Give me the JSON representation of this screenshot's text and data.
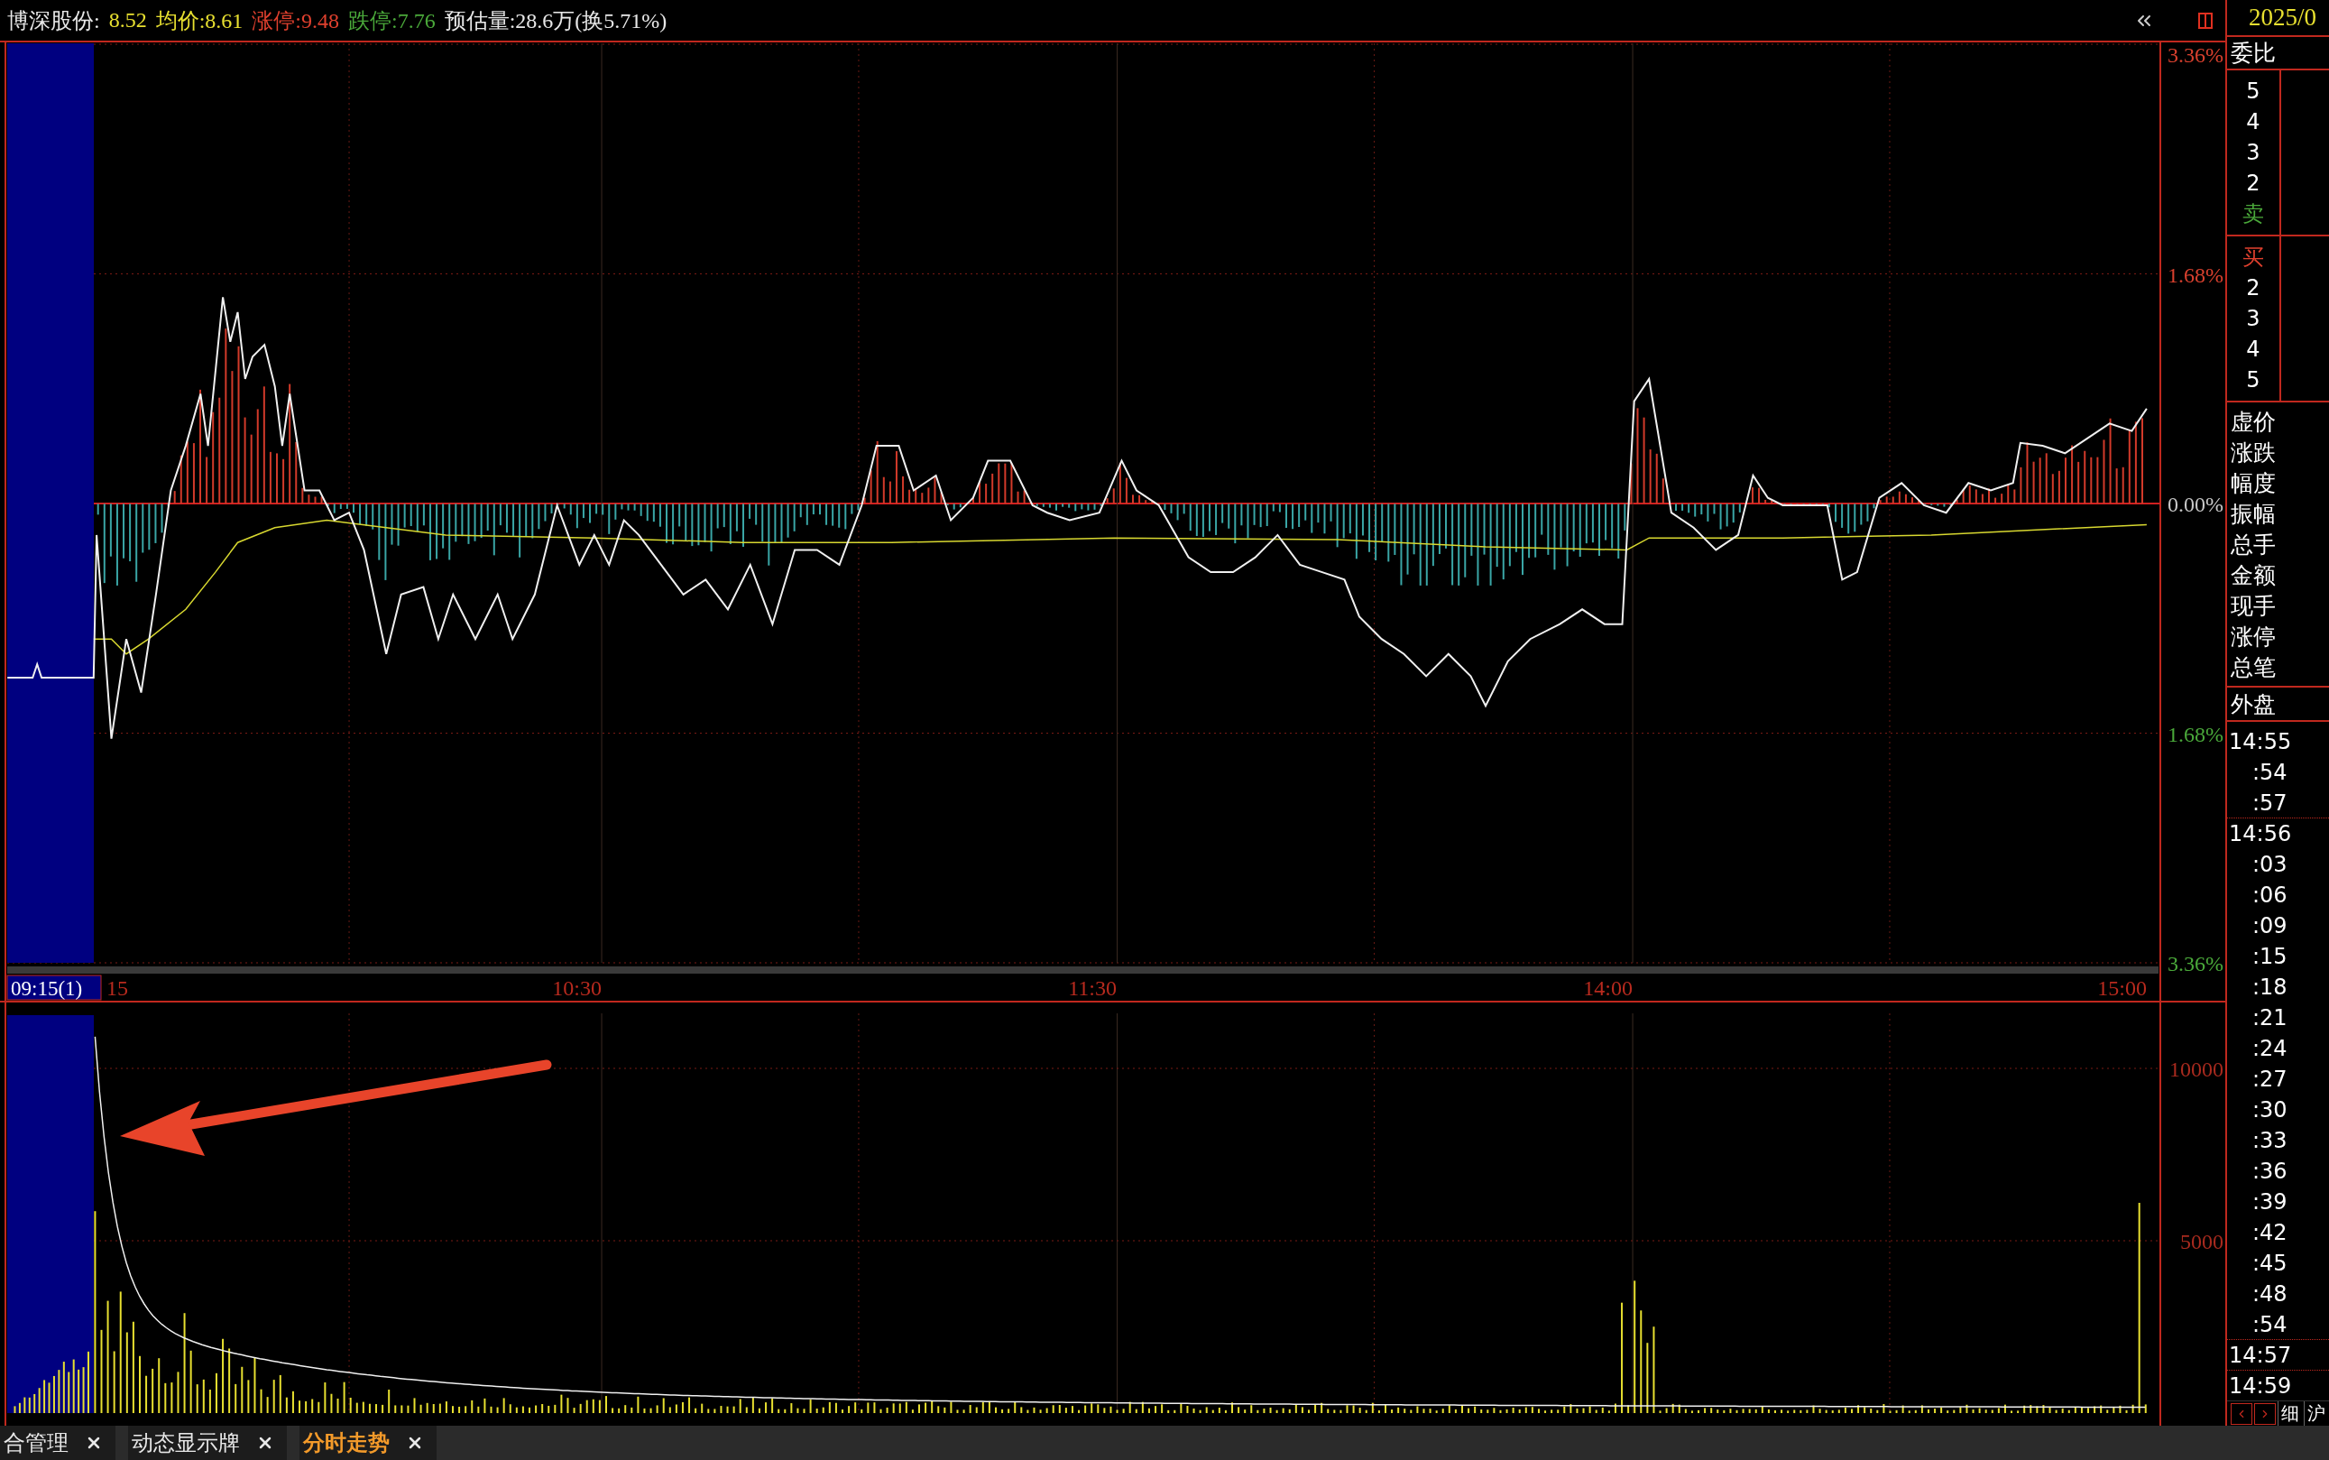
{
  "quote": {
    "name": "博深股份:",
    "price": "8.52",
    "average": "均价:8.61",
    "limit_up": "涨停:9.48",
    "limit_down": "跌停:7.76",
    "estimate": "预估量:28.6万(换5.71%)"
  },
  "price_axis": [
    {
      "label": "3.36%",
      "kind": "up"
    },
    {
      "label": "1.68%",
      "kind": "up"
    },
    {
      "label": "0.00%",
      "kind": "flat"
    },
    {
      "label": "1.68%",
      "kind": "down"
    },
    {
      "label": "3.36%",
      "kind": "down"
    }
  ],
  "time_axis": {
    "cursor": "09:15(1)",
    "labels": [
      "15",
      "10:30",
      "11:30",
      "14:00",
      "15:00"
    ]
  },
  "volume_axis": [
    "10000",
    "5000"
  ],
  "panel": {
    "date": "2025/0",
    "ratio_label": "委比",
    "sell": {
      "levels": [
        "5",
        "4",
        "3",
        "2"
      ],
      "label": "卖"
    },
    "buy": {
      "label": "买",
      "levels": [
        "2",
        "3",
        "4",
        "5"
      ]
    },
    "stats": [
      "虚价",
      "涨跌",
      "幅度",
      "振幅",
      "总手",
      "金额",
      "现手",
      "涨停",
      "总笔"
    ],
    "outer": "外盘",
    "ticks": [
      {
        "time": "14:55",
        "kind": "minute"
      },
      {
        "time": ":54",
        "kind": "second"
      },
      {
        "time": ":57",
        "kind": "second"
      },
      {
        "time": "14:56",
        "kind": "minute"
      },
      {
        "time": ":03",
        "kind": "second"
      },
      {
        "time": ":06",
        "kind": "second"
      },
      {
        "time": ":09",
        "kind": "second"
      },
      {
        "time": ":15",
        "kind": "second"
      },
      {
        "time": ":18",
        "kind": "second"
      },
      {
        "time": ":21",
        "kind": "second"
      },
      {
        "time": ":24",
        "kind": "second"
      },
      {
        "time": ":27",
        "kind": "second"
      },
      {
        "time": ":30",
        "kind": "second"
      },
      {
        "time": ":33",
        "kind": "second"
      },
      {
        "time": ":36",
        "kind": "second"
      },
      {
        "time": ":39",
        "kind": "second"
      },
      {
        "time": ":42",
        "kind": "second"
      },
      {
        "time": ":45",
        "kind": "second"
      },
      {
        "time": ":48",
        "kind": "second"
      },
      {
        "time": ":54",
        "kind": "second"
      },
      {
        "time": "14:57",
        "kind": "minute"
      },
      {
        "time": "14:59",
        "kind": "minute"
      }
    ],
    "subtabs": [
      "细",
      "沪"
    ]
  },
  "tabs": [
    {
      "label": "合管理",
      "selected": false
    },
    {
      "label": "动态显示牌",
      "selected": false
    },
    {
      "label": "分时走势",
      "selected": true
    }
  ]
}
